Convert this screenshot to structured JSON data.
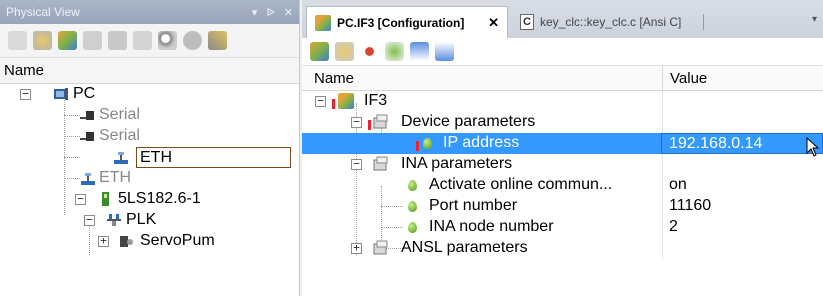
{
  "left_panel": {
    "title": "Physical View",
    "pin": "▾ ᐉ ✕",
    "header": "Name",
    "tree": [
      {
        "label": "PC",
        "grey": false
      },
      {
        "label": "Serial",
        "grey": true
      },
      {
        "label": "Serial",
        "grey": true
      },
      {
        "label": "ETH",
        "grey": false,
        "editing": true
      },
      {
        "label": "ETH",
        "grey": true
      },
      {
        "label": "5LS182.6-1",
        "grey": false
      },
      {
        "label": "PLK",
        "grey": false
      },
      {
        "label": "ServoPum",
        "grey": false
      }
    ]
  },
  "tabs": [
    {
      "label": "PC.IF3 [Configuration]",
      "close": "✕",
      "active": true
    },
    {
      "label": "key_clc::key_clc.c [Ansi C]",
      "active": false
    }
  ],
  "tab_overflow": "▾",
  "right_panel": {
    "header_name": "Name",
    "header_value": "Value",
    "rows": [
      {
        "label": "IF3",
        "value": ""
      },
      {
        "label": "Device parameters",
        "value": ""
      },
      {
        "label": "IP address",
        "value": "192.168.0.14",
        "selected": true
      },
      {
        "label": "INA parameters",
        "value": ""
      },
      {
        "label": "Activate online commun...",
        "value": "on"
      },
      {
        "label": "Port number",
        "value": "11160"
      },
      {
        "label": "INA node number",
        "value": "2"
      },
      {
        "label": "ANSL parameters",
        "value": ""
      }
    ]
  },
  "colors": {
    "selection": "#3399ff",
    "title_bar": "#9fadc0",
    "edit_border": "#7a4a1a"
  }
}
